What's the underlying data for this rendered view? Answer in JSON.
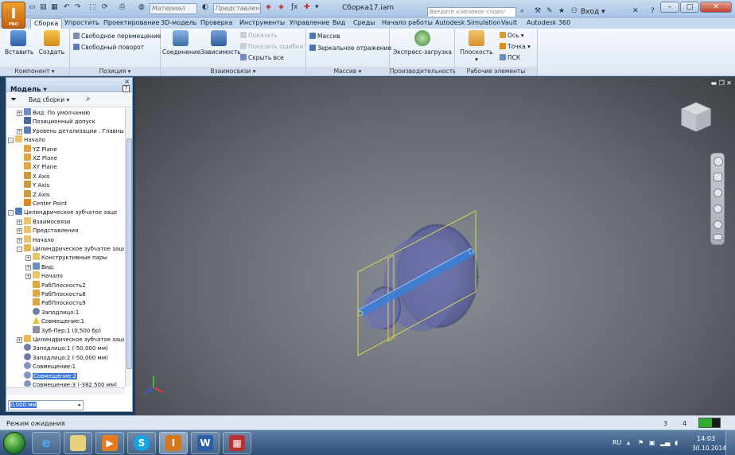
{
  "title_bar": {
    "app_logo": "I",
    "app_logo_sub": "PRO",
    "material_combo": "Материал",
    "appearance_combo": "Представлен",
    "document_title": "Сборка17.iam",
    "search_placeholder": "Введите ключевое слово/фразу",
    "login_label": "Вход",
    "minimize": "–",
    "maximize": "□",
    "close": "✕",
    "help": "?"
  },
  "ribbon_tabs": [
    "Сборка",
    "Упростить",
    "Проектирование",
    "3D-модель",
    "Проверка",
    "Инструменты",
    "Управление",
    "Вид",
    "Среды",
    "Начало работы",
    "Autodesk Simulation",
    "Vault",
    "Autodesk 360"
  ],
  "ribbon": {
    "component": {
      "title": "Компонент",
      "insert": "Вставить",
      "create": "Создать"
    },
    "position": {
      "title": "Позиция",
      "free_move": "Свободное перемещение",
      "free_rotate": "Свободный поворот"
    },
    "relationships": {
      "title": "Взаимосвязи",
      "joint": "Соединение",
      "constraint": "Зависимость",
      "show": "Показать",
      "show_errors": "Показать ошибки",
      "hide_all": "Скрыть все"
    },
    "pattern": {
      "title": "Массив",
      "pattern": "Массив",
      "mirror": "Зеркальное отражение"
    },
    "productivity": {
      "title": "Производительность",
      "express_load": "Экспресс-загрузка"
    },
    "work_features": {
      "title": "Рабочие элементы",
      "plane": "Плоскость",
      "axis": "Ось",
      "point": "Точка",
      "ucs": "ПСК"
    }
  },
  "browser": {
    "title": "Модель",
    "view_mode": "Вид сборки",
    "close": "×",
    "help": "?",
    "tree": [
      {
        "label": "Вид: По умолчанию",
        "indent": 1,
        "expander": "+",
        "icon": "view"
      },
      {
        "label": "Позиционный допуск",
        "indent": 1,
        "expander": "",
        "icon": "tolerance"
      },
      {
        "label": "Уровень детализации : Главны",
        "indent": 1,
        "expander": "+",
        "icon": "lod"
      },
      {
        "label": "Начало",
        "indent": 0,
        "expander": "-",
        "icon": "folder"
      },
      {
        "label": "YZ Plane",
        "indent": 1,
        "expander": "",
        "icon": "plane"
      },
      {
        "label": "XZ Plane",
        "indent": 1,
        "expander": "",
        "icon": "plane"
      },
      {
        "label": "XY Plane",
        "indent": 1,
        "expander": "",
        "icon": "plane"
      },
      {
        "label": "X Axis",
        "indent": 1,
        "expander": "",
        "icon": "axis"
      },
      {
        "label": "Y Axis",
        "indent": 1,
        "expander": "",
        "icon": "axis"
      },
      {
        "label": "Z Axis",
        "indent": 1,
        "expander": "",
        "icon": "axis"
      },
      {
        "label": "Center Point",
        "indent": 1,
        "expander": "",
        "icon": "point"
      },
      {
        "label": "Цилиндрическое зубчатое заце",
        "indent": 0,
        "expander": "-",
        "icon": "assembly"
      },
      {
        "label": "Взаимосвязи",
        "indent": 1,
        "expander": "+",
        "icon": "folder"
      },
      {
        "label": "Представления",
        "indent": 1,
        "expander": "+",
        "icon": "folder"
      },
      {
        "label": "Начало",
        "indent": 1,
        "expander": "+",
        "icon": "folder"
      },
      {
        "label": "Цилиндрическое зубчатое заце",
        "indent": 1,
        "expander": "-",
        "icon": "part"
      },
      {
        "label": "Конструктивные пары",
        "indent": 2,
        "expander": "+",
        "icon": "folder"
      },
      {
        "label": "Вид:",
        "indent": 2,
        "expander": "+",
        "icon": "view"
      },
      {
        "label": "Начало",
        "indent": 2,
        "expander": "+",
        "icon": "folder"
      },
      {
        "label": "РабПлоскость2",
        "indent": 2,
        "expander": "",
        "icon": "plane"
      },
      {
        "label": "РабПлоскость8",
        "indent": 2,
        "expander": "",
        "icon": "plane"
      },
      {
        "label": "РабПлоскость9",
        "indent": 2,
        "expander": "",
        "icon": "plane"
      },
      {
        "label": "Заподлицо:1",
        "indent": 2,
        "expander": "",
        "icon": "flush"
      },
      {
        "label": "Совмещение:1",
        "indent": 2,
        "expander": "",
        "icon": "warning"
      },
      {
        "label": "Зуб-Пер:1 (0,500 бр)",
        "indent": 2,
        "expander": "",
        "icon": "gear"
      },
      {
        "label": "Цилиндрическое зубчатое заце",
        "indent": 1,
        "expander": "+",
        "icon": "part"
      },
      {
        "label": "Заподлицо:1 (-50,000 мм)",
        "indent": 1,
        "expander": "",
        "icon": "flush"
      },
      {
        "label": "Заподлицо:2 (-50,000 мм)",
        "indent": 1,
        "expander": "",
        "icon": "flush"
      },
      {
        "label": "Совмещение:1",
        "indent": 1,
        "expander": "",
        "icon": "mate"
      },
      {
        "label": "Совмещение:2",
        "indent": 1,
        "expander": "",
        "icon": "mate",
        "selected": true
      },
      {
        "label": "Совмещение:3 (-382,500 мм)",
        "indent": 1,
        "expander": "",
        "icon": "mate"
      }
    ],
    "edit_value": "0,000 мм"
  },
  "status_bar": {
    "status": "Режим ожидания",
    "count1": "3",
    "count2": "4"
  },
  "taskbar": {
    "language": "RU",
    "time": "14:03",
    "date": "30.10.2014"
  },
  "colors": {
    "accent": "#3a78d8",
    "wireframe": "#e8e04a",
    "gear_fill": "#6e73a8",
    "axis_highlight": "#3b7fd6"
  }
}
